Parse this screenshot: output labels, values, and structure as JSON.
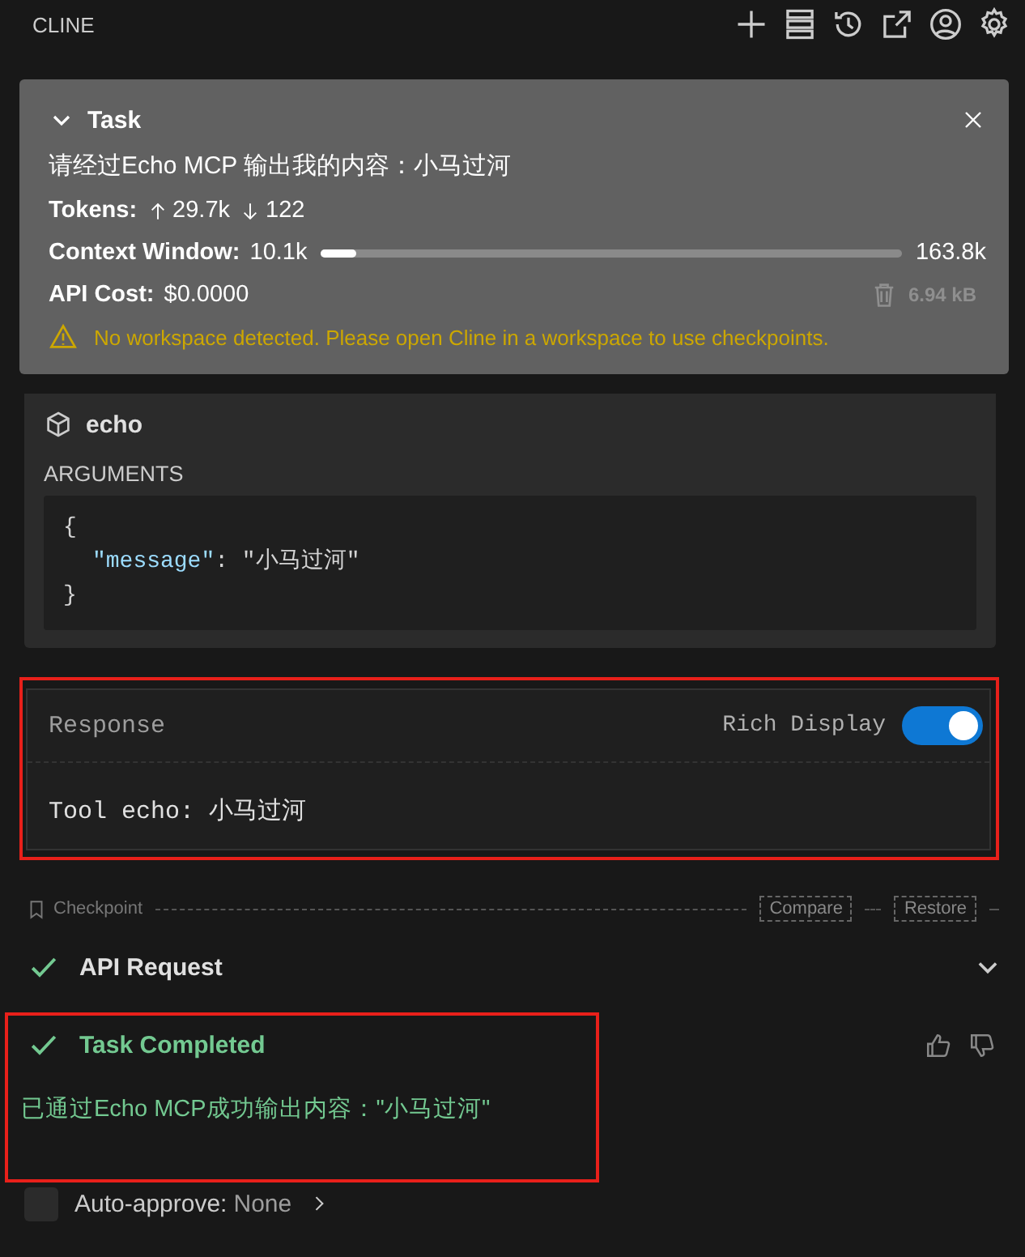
{
  "header": {
    "title": "CLINE"
  },
  "task": {
    "title": "Task",
    "expanded": true,
    "prompt": "请经过Echo MCP 输出我的内容：小马过河",
    "tokens_label": "Tokens:",
    "tokens_in": "29.7k",
    "tokens_out": "122",
    "context_label": "Context Window:",
    "context_used": "10.1k",
    "level": 0.062,
    "context_total": "163.8k",
    "cost_label": "API Cost:",
    "cost": "$0.0000",
    "size": "6.94 kB",
    "warning": "No workspace detected. Please open Cline in a workspace to use checkpoints."
  },
  "tool": {
    "name": "echo",
    "arguments_label": "ARGUMENTS",
    "lines": [
      {
        "indented": false,
        "parts": [
          {
            "kind": "punct",
            "text": "{"
          }
        ]
      },
      {
        "indented": true,
        "parts": [
          {
            "kind": "key",
            "text": "\"message\""
          },
          {
            "kind": "punct",
            "text": ": \"小马过河\""
          }
        ]
      },
      {
        "indented": false,
        "parts": [
          {
            "kind": "punct",
            "text": "}"
          }
        ]
      }
    ]
  },
  "response": {
    "title": "Response",
    "rich_display_label": "Rich Display",
    "rich_display": true,
    "text": "Tool echo: 小马过河",
    "highlighted": true
  },
  "checkpoint": {
    "label": "Checkpoint",
    "buttons": [
      "Compare",
      "Restore"
    ]
  },
  "messages": [
    {
      "kind": "api_request",
      "title": "API Request",
      "expanded": false,
      "highlighted": false
    },
    {
      "kind": "completion",
      "title": "Task Completed",
      "text": "已通过Echo MCP成功输出内容：\"小马过河\"",
      "highlighted": true
    }
  ],
  "auto_approve": {
    "checked": false,
    "label": "Auto-approve:",
    "value": "None"
  }
}
